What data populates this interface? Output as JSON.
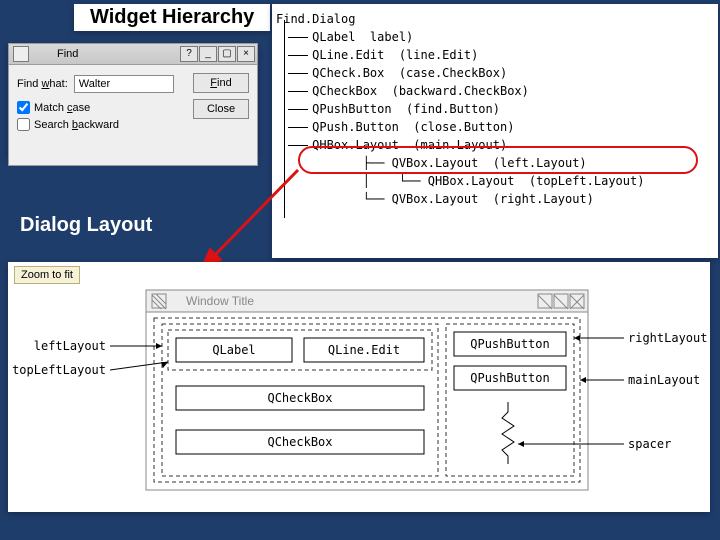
{
  "headings": {
    "hierarchy": "Widget Hierarchy",
    "layout": "Dialog Layout"
  },
  "find_dialog": {
    "title": "Find",
    "label": "Find what:",
    "label_u": "w",
    "value": "Walter",
    "match_case": "Match case",
    "match_case_u": "c",
    "search_backward": "Search backward",
    "search_backward_u": "b",
    "find_btn": "Find",
    "find_btn_u": "F",
    "close_btn": "Close",
    "min": "_",
    "max": "▢",
    "cls": "×",
    "help": "?"
  },
  "tree": {
    "root": "Find.Dialog",
    "items": [
      "QLabel  label)",
      "QLine.Edit  (line.Edit)",
      "QCheck.Box  (case.CheckBox)",
      "QCheckBox  (backward.CheckBox)",
      "QPushButton  (find.Button)",
      "QPush.Button  (close.Button)",
      "QHBox.Layout  (main.Layout)"
    ],
    "sub": [
      "QVBox.Layout  (left.Layout)",
      "QHBox.Layout  (topLeft.Layout)",
      "QVBox.Layout  (right.Layout)"
    ]
  },
  "layout": {
    "zoom": "Zoom to fit",
    "window_title": "Window Title",
    "left_labels": [
      "leftLayout",
      "topLeftLayout"
    ],
    "right_labels": [
      "rightLayout",
      "mainLayout",
      "spacer"
    ],
    "boxes": {
      "qlabel": "QLabel",
      "qlineedit": "QLine.Edit",
      "qcheck1": "QCheckBox",
      "qcheck2": "QCheckBox",
      "qpush1": "QPushButton",
      "qpush2": "QPushButton"
    }
  }
}
